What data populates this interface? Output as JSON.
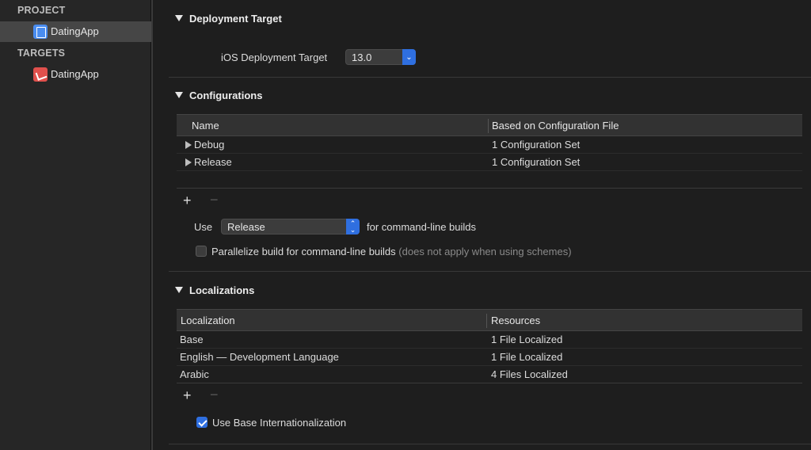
{
  "sidebar": {
    "project_header": "PROJECT",
    "project_item": "DatingApp",
    "targets_header": "TARGETS",
    "target_item": "DatingApp"
  },
  "deployment": {
    "title": "Deployment Target",
    "label": "iOS Deployment Target",
    "value": "13.0"
  },
  "configurations": {
    "title": "Configurations",
    "columns": [
      "Name",
      "Based on Configuration File"
    ],
    "rows": [
      {
        "name": "Debug",
        "file": "1 Configuration Set"
      },
      {
        "name": "Release",
        "file": "1 Configuration Set"
      }
    ],
    "use_label": "Use",
    "use_value": "Release",
    "use_suffix": "for command-line builds",
    "parallelize_label": "Parallelize build for command-line builds",
    "parallelize_note": "(does not apply when using schemes)",
    "parallelize_checked": false
  },
  "localizations": {
    "title": "Localizations",
    "columns": [
      "Localization",
      "Resources"
    ],
    "rows": [
      {
        "name": "Base",
        "resources": "1 File Localized"
      },
      {
        "name": "English — Development Language",
        "resources": "1 File Localized"
      },
      {
        "name": "Arabic",
        "resources": "4 Files Localized"
      }
    ],
    "base_intl_label": "Use Base Internationalization",
    "base_intl_checked": true
  },
  "glyphs": {
    "plus": "+",
    "minus": "−",
    "popup_arrows": "⌃⌄"
  },
  "colors": {
    "accent": "#2f6fe0",
    "background": "#1e1e1e",
    "sidebar": "#262626"
  }
}
